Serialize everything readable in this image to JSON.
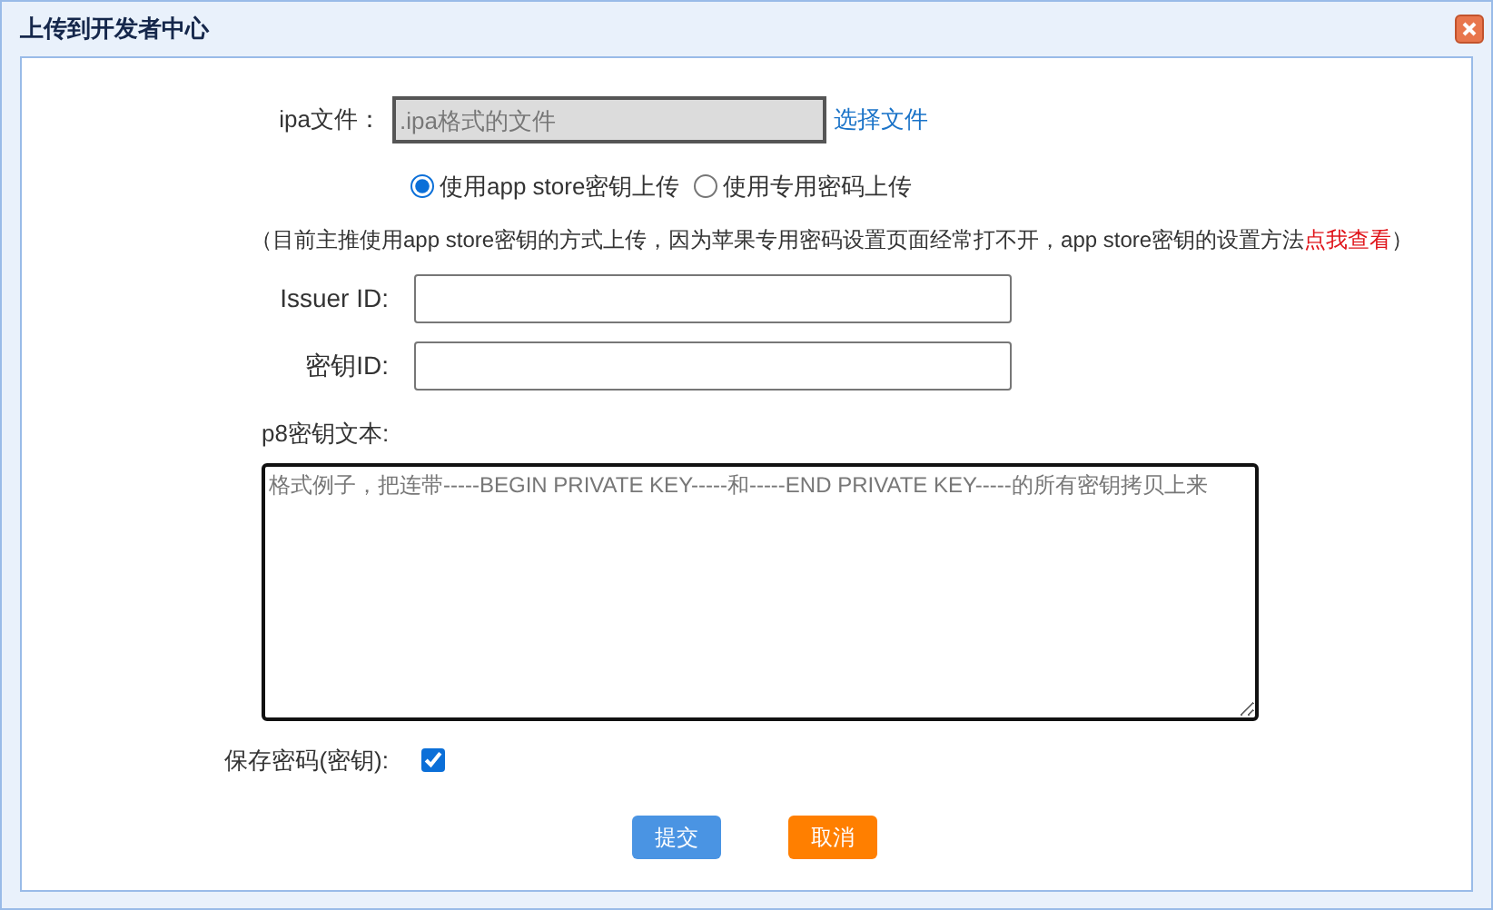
{
  "window": {
    "title": "上传到开发者中心"
  },
  "ipa_file": {
    "label": "ipa文件：",
    "placeholder": ".ipa格式的文件",
    "disabled": true,
    "link": "选择文件"
  },
  "upload_methods": [
    {
      "label": "使用app store密钥上传",
      "selected": true
    },
    {
      "label": "使用专用密码上传",
      "selected": false
    }
  ],
  "note": "（目前主推使用app store密钥的方式上传，因为苹果专用密码设置页面经常打不开，app store密钥的设置方法**点我查看**）",
  "fields": [
    {
      "label": "Issuer ID:"
    },
    {
      "label": "密钥ID:"
    }
  ],
  "p8_key": {
    "label": "p8密钥文本:",
    "placeholder": "格式例子，把连带-----BEGIN PRIVATE KEY-----和-----END PRIVATE KEY-----的所有密钥拷贝上来"
  },
  "save_password": {
    "label": "保存密码(密钥):",
    "checked": true
  },
  "buttons": [
    {
      "label": "提交",
      "kind": "primary"
    },
    {
      "label": "取消",
      "kind": "cancel"
    }
  ]
}
